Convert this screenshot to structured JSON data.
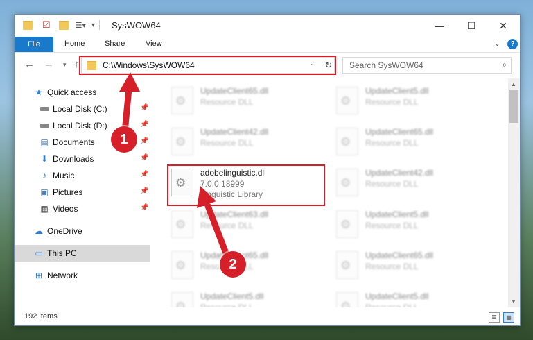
{
  "window": {
    "title": "SysWOW64"
  },
  "ribbon": {
    "tabs": [
      "File",
      "Home",
      "Share",
      "View"
    ],
    "help": "?"
  },
  "address": {
    "path": "C:\\Windows\\SysWOW64",
    "search_placeholder": "Search SysWOW64"
  },
  "sidebar": {
    "items": [
      {
        "label": "Quick access",
        "icon": "star-icon"
      },
      {
        "label": "Local Disk (C:)",
        "icon": "drive-icon"
      },
      {
        "label": "Local Disk (D:)",
        "icon": "drive-icon"
      },
      {
        "label": "Documents",
        "icon": "documents-icon"
      },
      {
        "label": "Downloads",
        "icon": "download-icon"
      },
      {
        "label": "Music",
        "icon": "music-icon"
      },
      {
        "label": "Pictures",
        "icon": "pictures-icon"
      },
      {
        "label": "Videos",
        "icon": "videos-icon"
      },
      {
        "label": "OneDrive",
        "icon": "cloud-icon"
      },
      {
        "label": "This PC",
        "icon": "computer-icon"
      },
      {
        "label": "Network",
        "icon": "network-icon"
      }
    ]
  },
  "files": {
    "left": [
      {
        "name": "UpdateClient65.dll",
        "type": "Resource DLL"
      },
      {
        "name": "UpdateClient42.dll",
        "type": "Resource DLL"
      },
      {
        "name": "adobelinguistic.dll",
        "version": "7.0.0.18999",
        "type": "Linguistic Library"
      },
      {
        "name": "UpdateClient63.dll",
        "type": "Resource DLL"
      },
      {
        "name": "UpdateClient65.dll",
        "type": "Resource DLL"
      },
      {
        "name": "UpdateClient5.dll",
        "type": "Resource DLL"
      }
    ],
    "right": [
      {
        "name": "UpdateClient5.dll",
        "type": "Resource DLL"
      },
      {
        "name": "UpdateClient65.dll",
        "type": "Resource DLL"
      },
      {
        "name": "UpdateClient42.dll",
        "type": "Resource DLL"
      },
      {
        "name": "UpdateClient5.dll",
        "type": "Resource DLL"
      },
      {
        "name": "UpdateClient65.dll",
        "type": "Resource DLL"
      },
      {
        "name": "UpdateClient5.dll",
        "type": "Resource DLL"
      }
    ]
  },
  "status": {
    "item_count": "192 items"
  },
  "callouts": {
    "step1": "1",
    "step2": "2"
  },
  "colors": {
    "accent": "#1979ca",
    "highlight": "#d5202a"
  }
}
